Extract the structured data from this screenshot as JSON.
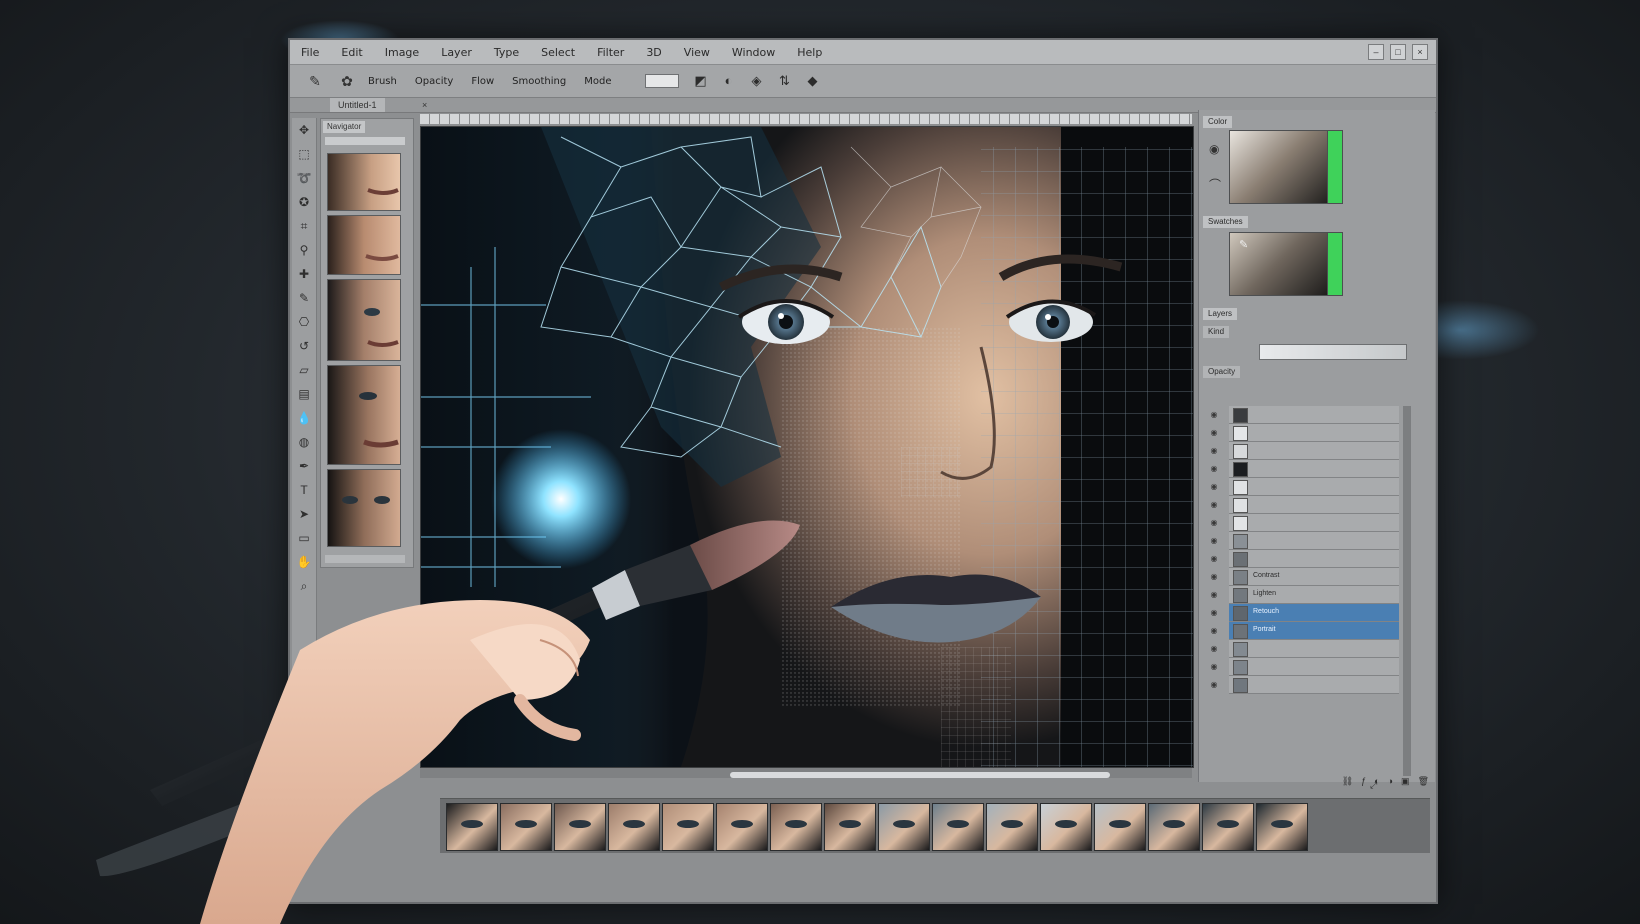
{
  "menu": [
    "File",
    "Edit",
    "Image",
    "Layer",
    "Type",
    "Select",
    "Filter",
    "3D",
    "View",
    "Window",
    "Help"
  ],
  "options_bar": {
    "labels": [
      "Brush",
      "Opacity",
      "Flow",
      "Smoothing",
      "Mode"
    ]
  },
  "document": {
    "tab_label": "Untitled-1",
    "close_glyph": "×"
  },
  "navigator": {
    "tab_label": "Navigator"
  },
  "right_panels": {
    "color_title": "Color",
    "swatches_title": "Swatches",
    "layers_title": "Layers",
    "layers_kind": "Kind",
    "layers_opacity": "Opacity",
    "layers": [
      {
        "name": "",
        "selected": false
      },
      {
        "name": "",
        "selected": false
      },
      {
        "name": "",
        "selected": false
      },
      {
        "name": "",
        "selected": false
      },
      {
        "name": "",
        "selected": false
      },
      {
        "name": "",
        "selected": false
      },
      {
        "name": "",
        "selected": false
      },
      {
        "name": "",
        "selected": false
      },
      {
        "name": "",
        "selected": false
      },
      {
        "name": "Contrast",
        "selected": false
      },
      {
        "name": "Lighten",
        "selected": false
      },
      {
        "name": "Retouch",
        "selected": true
      },
      {
        "name": "Portrait",
        "selected": true
      },
      {
        "name": "",
        "selected": false
      },
      {
        "name": "",
        "selected": false
      },
      {
        "name": "",
        "selected": false
      }
    ]
  },
  "colors": {
    "accent": "#4a7fb3",
    "glow": "#7fd6ff",
    "swatch_green": "#3fd25a"
  },
  "icons": {
    "tools": [
      "move-icon",
      "marquee-icon",
      "lasso-icon",
      "quick-select-icon",
      "crop-icon",
      "eyedropper-icon",
      "healing-icon",
      "brush-icon",
      "stamp-icon",
      "history-brush-icon",
      "eraser-icon",
      "gradient-icon",
      "blur-icon",
      "dodge-icon",
      "pen-icon",
      "type-icon",
      "path-select-icon",
      "shape-icon",
      "hand-icon",
      "zoom-icon"
    ]
  }
}
